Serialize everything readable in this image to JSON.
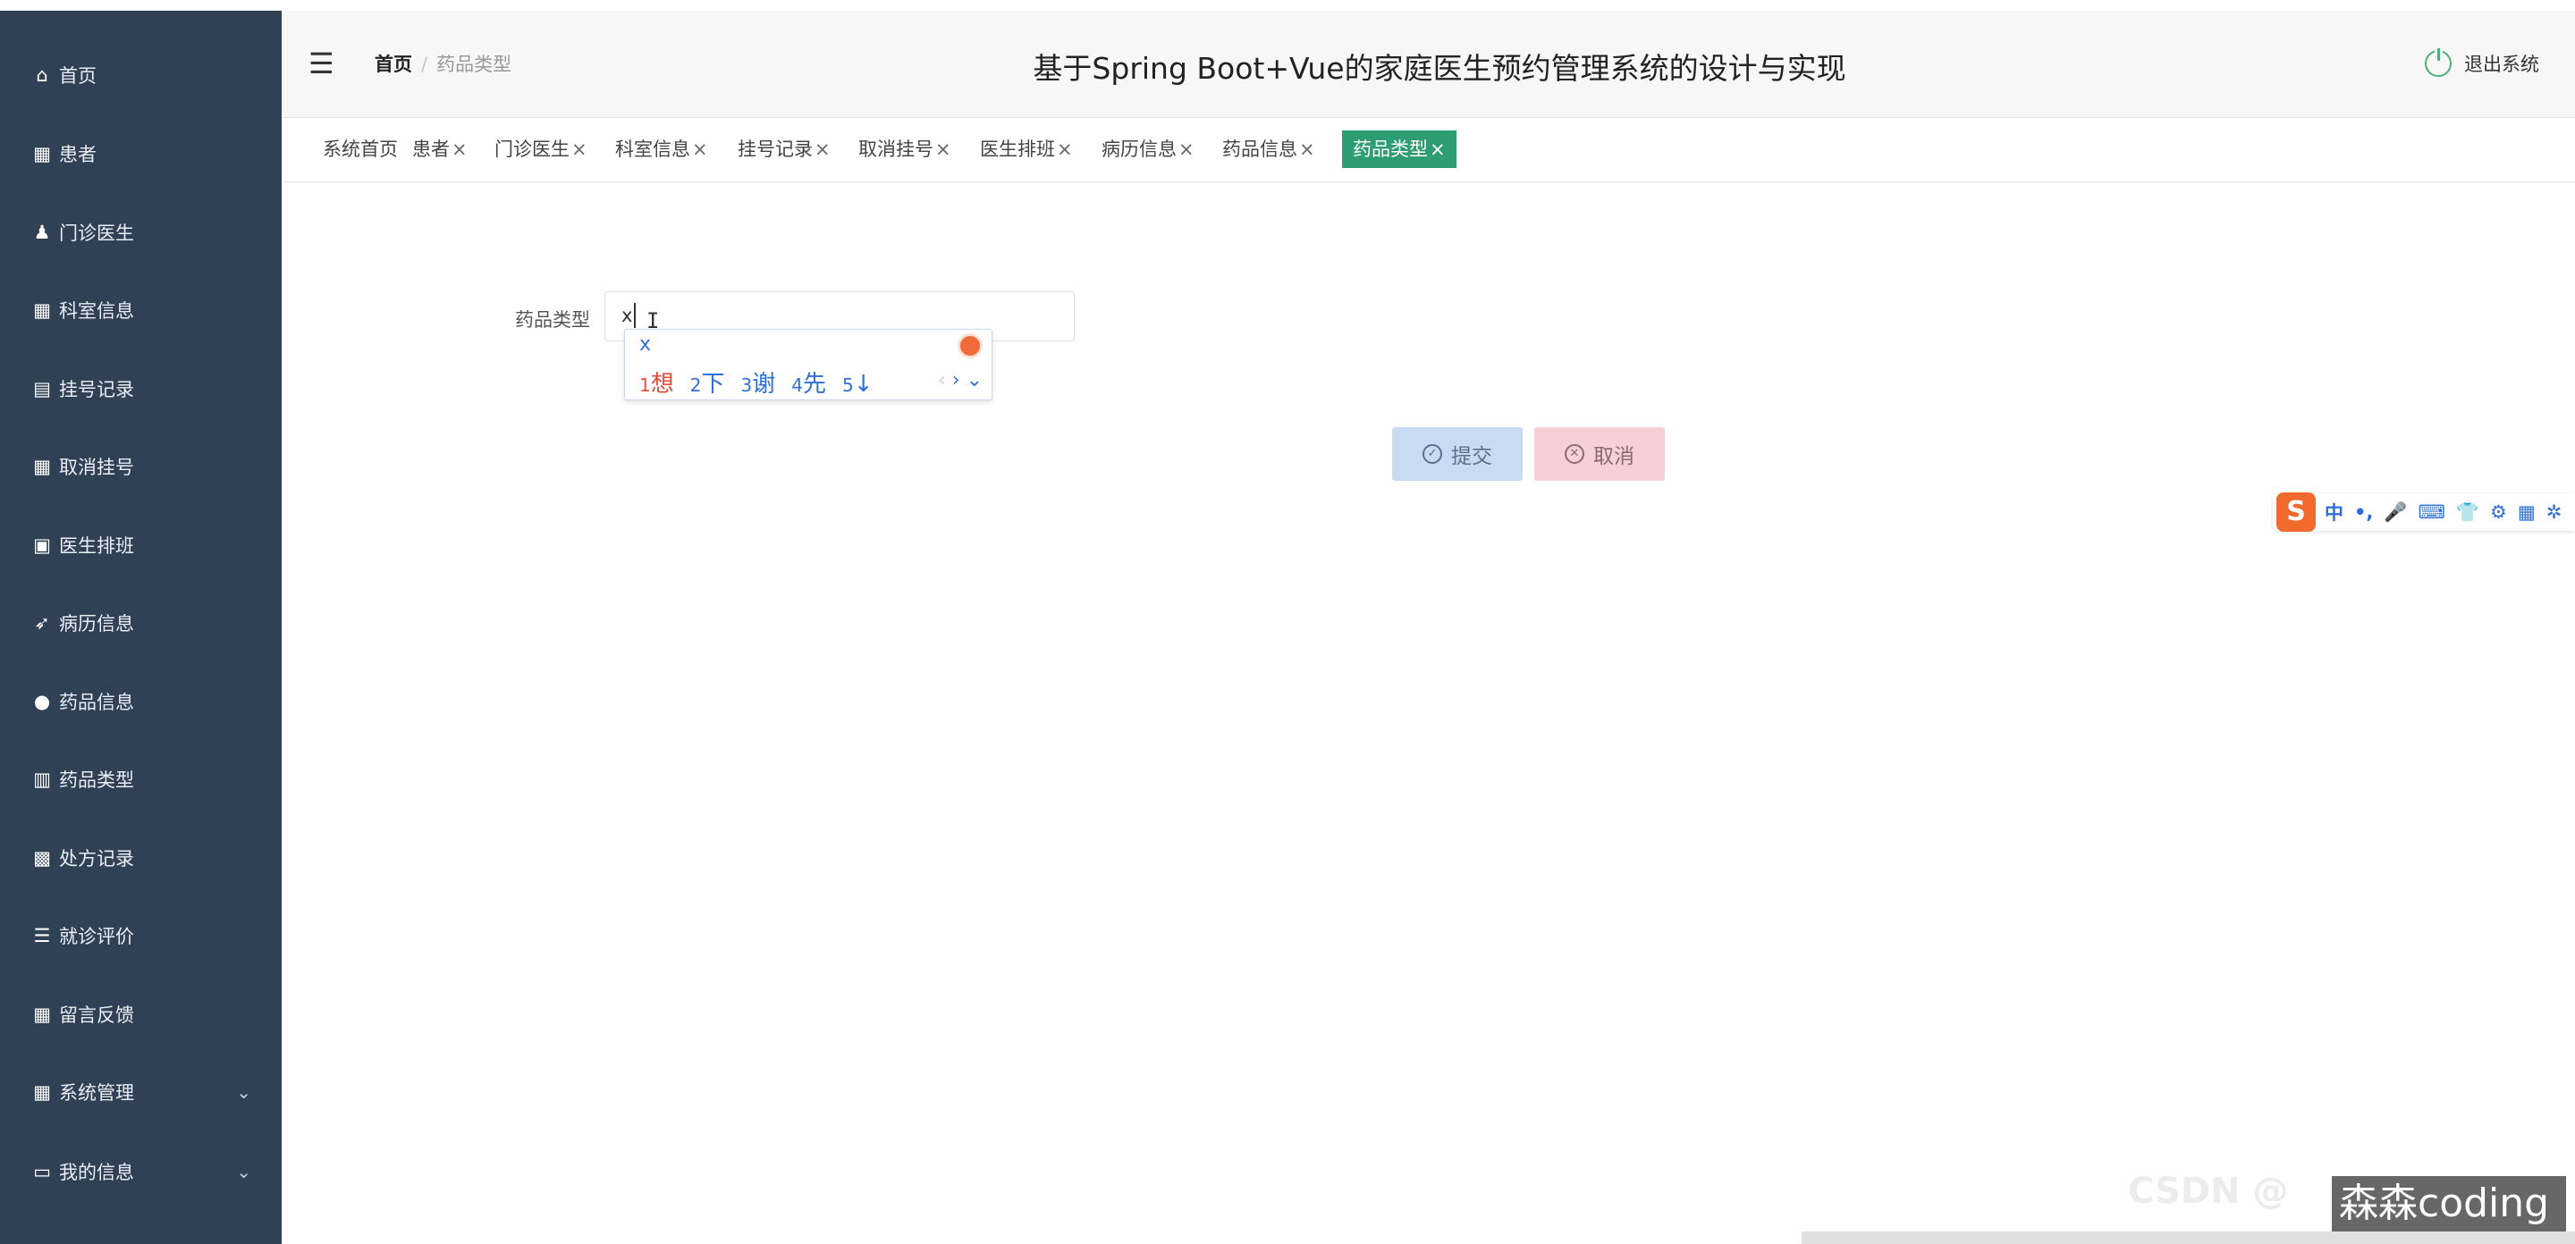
{
  "sidebar": {
    "items": [
      {
        "label": "首页",
        "icon": "⌂",
        "icon_name": "home-icon"
      },
      {
        "label": "患者",
        "icon": "▦",
        "icon_name": "grid-icon"
      },
      {
        "label": "门诊医生",
        "icon": "♟",
        "icon_name": "doctor-icon"
      },
      {
        "label": "科室信息",
        "icon": "▦",
        "icon_name": "grid-icon"
      },
      {
        "label": "挂号记录",
        "icon": "▤",
        "icon_name": "comment-icon"
      },
      {
        "label": "取消挂号",
        "icon": "▦",
        "icon_name": "grid-icon"
      },
      {
        "label": "医生排班",
        "icon": "▣",
        "icon_name": "clipboard-icon"
      },
      {
        "label": "病历信息",
        "icon": "➶",
        "icon_name": "send-icon"
      },
      {
        "label": "药品信息",
        "icon": "●",
        "icon_name": "location-icon"
      },
      {
        "label": "药品类型",
        "icon": "▥",
        "icon_name": "chart-icon"
      },
      {
        "label": "处方记录",
        "icon": "▩",
        "icon_name": "table-icon"
      },
      {
        "label": "就诊评价",
        "icon": "☰",
        "icon_name": "sliders-icon"
      },
      {
        "label": "留言反馈",
        "icon": "▦",
        "icon_name": "grid-icon"
      },
      {
        "label": "系统管理",
        "icon": "▦",
        "icon_name": "grid-icon",
        "expandable": true
      },
      {
        "label": "我的信息",
        "icon": "▭",
        "icon_name": "card-icon",
        "expandable": true
      }
    ]
  },
  "header": {
    "breadcrumb_home": "首页",
    "breadcrumb_separator": "/",
    "breadcrumb_current": "药品类型",
    "title": "基于Spring Boot+Vue的家庭医生预约管理系统的设计与实现",
    "logout_label": "退出系统"
  },
  "tabs": [
    {
      "label": "系统首页",
      "closable": false
    },
    {
      "label": "患者",
      "closable": true
    },
    {
      "label": "门诊医生",
      "closable": true
    },
    {
      "label": "科室信息",
      "closable": true
    },
    {
      "label": "挂号记录",
      "closable": true
    },
    {
      "label": "取消挂号",
      "closable": true
    },
    {
      "label": "医生排班",
      "closable": true
    },
    {
      "label": "病历信息",
      "closable": true
    },
    {
      "label": "药品信息",
      "closable": true
    },
    {
      "label": "药品类型",
      "closable": true,
      "active": true
    }
  ],
  "tab_close_glyph": "×",
  "form": {
    "field_label": "药品类型",
    "field_value": "x",
    "submit_label": "提交",
    "cancel_label": "取消"
  },
  "ime_popup": {
    "composition": "x",
    "candidates": [
      {
        "num": "1",
        "text": "想"
      },
      {
        "num": "2",
        "text": "下"
      },
      {
        "num": "3",
        "text": "谢"
      },
      {
        "num": "4",
        "text": "先"
      },
      {
        "num": "5",
        "text": "↓"
      }
    ],
    "nav_prev": "‹",
    "nav_next": "›",
    "nav_expand": "⌄"
  },
  "ime_toolbar": {
    "logo": "S",
    "mode": "中",
    "items": [
      "•,",
      "🎤",
      "⌨",
      "👕",
      "⚙",
      "▦",
      "✲"
    ]
  },
  "watermark": {
    "text": "森森coding",
    "ghost_text": "CSDN @"
  },
  "colors": {
    "sidebar_bg": "#304156",
    "active_tab": "#2e9d74",
    "submit_bg": "#c8dbf3",
    "cancel_bg": "#f6d0d6"
  }
}
